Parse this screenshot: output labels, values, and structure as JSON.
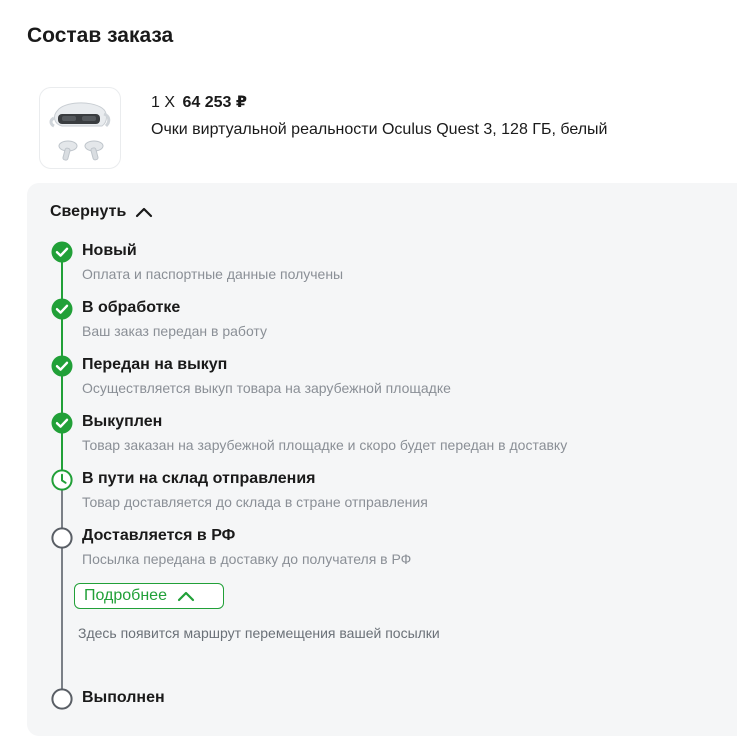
{
  "section": {
    "title": "Состав заказа"
  },
  "product": {
    "quantity_prefix": "1 X",
    "price": "64 253 ₽",
    "name": "Очки виртуальной реальности Oculus Quest 3, 128 ГБ, белый",
    "thumbnail_icon": "vr-headset-image"
  },
  "timeline": {
    "collapse_label": "Свернуть",
    "steps": [
      {
        "title": "Новый",
        "description": "Оплата и паспортные данные получены",
        "status": "done"
      },
      {
        "title": "В обработке",
        "description": "Ваш заказ передан в работу",
        "status": "done"
      },
      {
        "title": "Передан на выкуп",
        "description": "Осуществляется выкуп товара на зарубежной площадке",
        "status": "done"
      },
      {
        "title": "Выкуплен",
        "description": "Товар заказан на зарубежной площадке и скоро будет передан в доставку",
        "status": "done"
      },
      {
        "title": "В пути на склад отправления",
        "description": "Товар доставляется до склада в стране отправления",
        "status": "in-progress"
      },
      {
        "title": "Доставляется в РФ",
        "description": "Посылка передана в доставку до получателя в РФ",
        "status": "pending"
      },
      {
        "title": "Выполнен",
        "description": "",
        "status": "pending"
      }
    ],
    "more_button_label": "Подробнее",
    "route_note": "Здесь появится маршрут перемещения вашей посылки"
  },
  "colors": {
    "accent_green": "#21a038",
    "pending_gray": "#5a5f66",
    "panel_background": "#f5f6f7",
    "secondary_text": "#8a8f96"
  }
}
